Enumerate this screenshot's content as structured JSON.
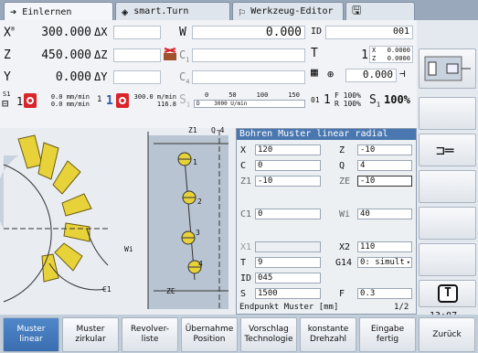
{
  "tabs": [
    {
      "label": "Einlernen",
      "icon": "arrow-right-icon"
    },
    {
      "label": "smart.Turn",
      "icon": "diamond-arrow-icon"
    },
    {
      "label": "Werkzeug-Editor",
      "icon": "tool-editor-icon"
    },
    {
      "label": "",
      "icon": "save-icon"
    }
  ],
  "status": {
    "x_label": "X",
    "x_sup": "®",
    "x_value": "300.000",
    "dx_label": "ΔX",
    "z_label": "Z",
    "z_value": "450.000",
    "dz_label": "ΔZ",
    "y_label": "Y",
    "y_value": "0.000",
    "dy_label": "ΔY",
    "w_label": "W",
    "w_value": "0.000",
    "id_label": "ID",
    "id_value": "001",
    "c1_label": "C",
    "c1_sub": "1",
    "c4_label": "C",
    "c4_sub": "4",
    "t_label": "T",
    "t_value": "1",
    "tx_label": "X",
    "tx_value": "0.0000",
    "tz_label": "Z",
    "tz_value": "0.0000",
    "angle_value": "0.000",
    "s1_label": "S1",
    "s1_num": "1",
    "s1_rate_a": "0.0 mm/min",
    "s1_rate_b": "0.0 mm/min",
    "mid_num_a": "1",
    "mid_num_b": "1",
    "feed_a": "300.0 m/min",
    "feed_b": "116.8",
    "s_label": "S",
    "s_sub": "1",
    "d_label": "D",
    "rpm_ticks": [
      "0",
      "50",
      "100",
      "150"
    ],
    "rpm_value": "3000 U/min",
    "g01": "01",
    "f_label": "F",
    "f_pct": "100%",
    "r_label": "R",
    "r_pct": "100%",
    "s1_pct_label": "S",
    "s1_pct_sub": "1",
    "s1_pct": "100%"
  },
  "graphic": {
    "z1_label": "Z1",
    "q4_label": "Q-4",
    "wi_label": "Wi",
    "c1_label": "C1",
    "ze_label": "ZE",
    "hole_labels": [
      "1",
      "2",
      "3",
      "4"
    ]
  },
  "form": {
    "title": "Bohren Muster linear radial",
    "fields": {
      "x": {
        "label": "X",
        "value": "120"
      },
      "z": {
        "label": "Z",
        "value": "-10"
      },
      "c": {
        "label": "C",
        "value": "0"
      },
      "q": {
        "label": "Q",
        "value": "4"
      },
      "z1": {
        "label": "Z1",
        "value": "-10"
      },
      "ze": {
        "label": "ZE",
        "value": "-10"
      },
      "c1": {
        "label": "C1",
        "value": "0"
      },
      "wi": {
        "label": "Wi",
        "value": "40"
      },
      "x1": {
        "label": "X1",
        "value": ""
      },
      "x2": {
        "label": "X2",
        "value": "110"
      },
      "t": {
        "label": "T",
        "value": "9"
      },
      "g14": {
        "label": "G14",
        "value": "0: simult"
      },
      "id": {
        "label": "ID",
        "value": "045"
      },
      "s": {
        "label": "S",
        "value": "1500"
      },
      "f": {
        "label": "F",
        "value": "0.3"
      }
    },
    "footer": "Endpunkt Muster [mm]",
    "page": "1/2"
  },
  "clock": "13:07",
  "softkeys": [
    {
      "line1": "Muster",
      "line2": "linear",
      "active": true
    },
    {
      "line1": "Muster",
      "line2": "zirkular",
      "active": false
    },
    {
      "line1": "Revolver-",
      "line2": "liste",
      "active": false
    },
    {
      "line1": "Übernahme",
      "line2": "Position",
      "active": false
    },
    {
      "line1": "Vorschlag",
      "line2": "Technologie",
      "active": false
    },
    {
      "line1": "konstante",
      "line2": "Drehzahl",
      "active": false
    },
    {
      "line1": "Eingabe",
      "line2": "fertig",
      "active": false
    },
    {
      "line1": "Zurück",
      "line2": "",
      "active": false
    }
  ],
  "colors": {
    "accent": "#4a77b0",
    "drill": "#e8d23a",
    "stop_red": "#d9242a"
  }
}
